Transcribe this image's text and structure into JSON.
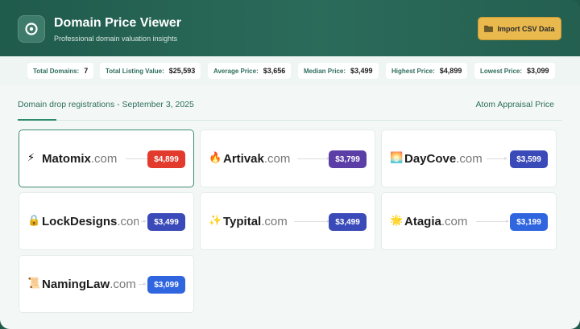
{
  "header": {
    "title": "Domain Price Viewer",
    "subtitle": "Professional domain valuation insights",
    "import_label": "Import CSV Data",
    "import_icon": "folder-icon"
  },
  "stats": [
    {
      "label": "Total Domains:",
      "value": "7"
    },
    {
      "label": "Total Listing Value:",
      "value": "$25,593"
    },
    {
      "label": "Average Price:",
      "value": "$3,656"
    },
    {
      "label": "Median Price:",
      "value": "$3,499"
    },
    {
      "label": "Highest Price:",
      "value": "$4,899"
    },
    {
      "label": "Lowest Price:",
      "value": "$3,099"
    }
  ],
  "section": {
    "title": "Domain drop registrations - September 3, 2025",
    "right_label": "Atom Appraisal Price"
  },
  "domains": [
    {
      "emoji": "⚡",
      "name": "Matomix",
      "tld": ".com",
      "price": "$4,899",
      "color": "#e23b2e",
      "selected": true
    },
    {
      "emoji": "🔥",
      "name": "Artivak",
      "tld": ".com",
      "price": "$3,799",
      "color": "#5b3fa6",
      "selected": false
    },
    {
      "emoji": "🌅",
      "name": "DayCove",
      "tld": ".com",
      "price": "$3,599",
      "color": "#3a4ab8",
      "selected": false
    },
    {
      "emoji": "🔒",
      "name": "LockDesigns",
      "tld": ".com",
      "price": "$3,499",
      "color": "#3a4ab8",
      "selected": false
    },
    {
      "emoji": "✨",
      "name": "Typital",
      "tld": ".com",
      "price": "$3,499",
      "color": "#3a4ab8",
      "selected": false
    },
    {
      "emoji": "🌟",
      "name": "Atagia",
      "tld": ".com",
      "price": "$3,199",
      "color": "#2f66e0",
      "selected": false
    },
    {
      "emoji": "📜",
      "name": "NamingLaw",
      "tld": ".com",
      "price": "$3,099",
      "color": "#2f66e0",
      "selected": false
    }
  ]
}
